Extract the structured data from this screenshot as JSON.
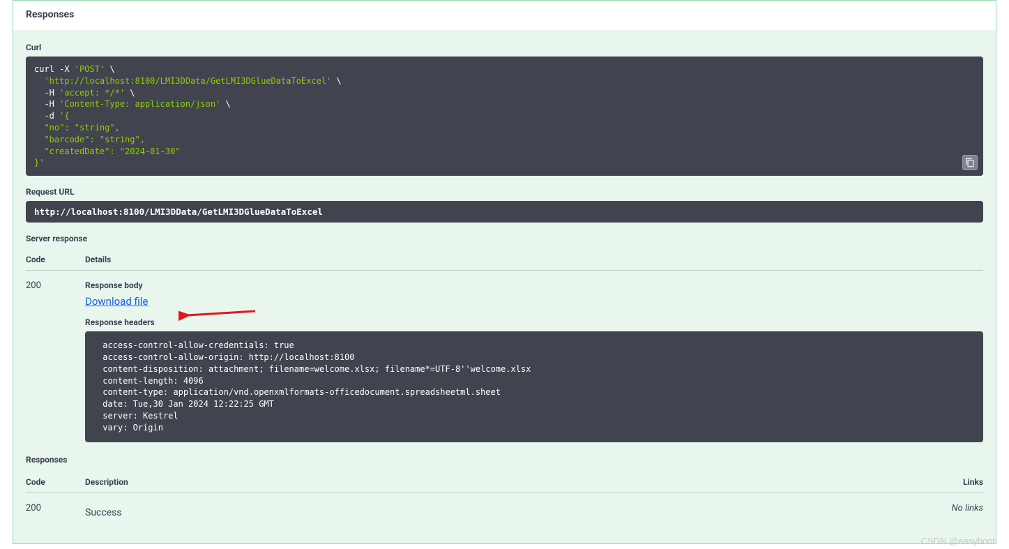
{
  "responses_title": "Responses",
  "curl": {
    "label": "Curl",
    "line1_a": "curl -X ",
    "line1_b": "'POST'",
    "line1_c": " \\",
    "line2_a": "  ",
    "line2_b": "'http://localhost:8100/LMI3DData/GetLMI3DGlueDataToExcel'",
    "line2_c": " \\",
    "line3_a": "  -H ",
    "line3_b": "'accept: */*'",
    "line3_c": " \\",
    "line4_a": "  -H ",
    "line4_b": "'Content-Type: application/json'",
    "line4_c": " \\",
    "line5_a": "  -d ",
    "line5_b": "'{",
    "line6": "  \"no\": \"string\",",
    "line7": "  \"barcode\": \"string\",",
    "line8": "  \"createdDate\": \"2024-01-30\"",
    "line9": "}'"
  },
  "request_url": {
    "label": "Request URL",
    "value": "http://localhost:8100/LMI3DData/GetLMI3DGlueDataToExcel"
  },
  "server_response_label": "Server response",
  "table1": {
    "code_header": "Code",
    "details_header": "Details",
    "code_value": "200",
    "response_body_label": "Response body",
    "download_link_text": "Download file",
    "response_headers_label": "Response headers",
    "headers_text": " access-control-allow-credentials: true \n access-control-allow-origin: http://localhost:8100 \n content-disposition: attachment; filename=welcome.xlsx; filename*=UTF-8''welcome.xlsx \n content-length: 4096 \n content-type: application/vnd.openxmlformats-officedocument.spreadsheetml.sheet \n date: Tue,30 Jan 2024 12:22:25 GMT \n server: Kestrel \n vary: Origin "
  },
  "responses2_label": "Responses",
  "table2": {
    "code_header": "Code",
    "description_header": "Description",
    "links_header": "Links",
    "code_value": "200",
    "description_value": "Success",
    "links_value": "No links"
  },
  "watermark": "CSDN @easyboot"
}
